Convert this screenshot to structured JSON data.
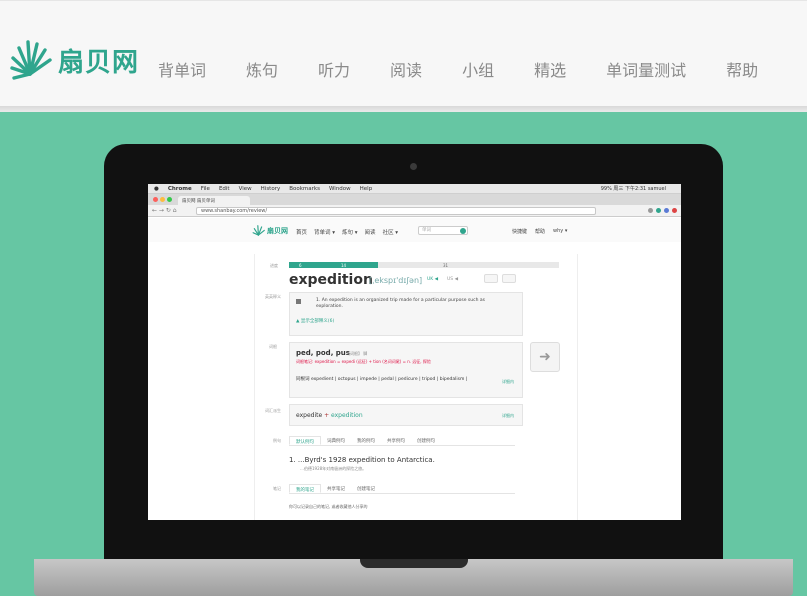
{
  "site": {
    "logo_text": "扇贝网",
    "logo_icon": "fan-shell-icon",
    "brand_color": "#2fa58d",
    "hero_color": "#66c6a3"
  },
  "nav": {
    "items": [
      "背单词",
      "炼句",
      "听力",
      "阅读",
      "小组",
      "精选",
      "单词量测试",
      "帮助"
    ]
  },
  "browser": {
    "menu": [
      "Chrome",
      "File",
      "Edit",
      "View",
      "History",
      "Bookmarks",
      "Window",
      "Help"
    ],
    "status": "99%  周三 下午2:31  samuel",
    "tab_title": "扇贝网  扇贝单词",
    "url": "www.shanbay.com/review/"
  },
  "inner_site": {
    "logo_text": "扇贝网",
    "nav": [
      "首页",
      "背单词 ▾",
      "炼句 ▾",
      "阅读",
      "社区 ▾"
    ],
    "search_placeholder": "单词",
    "right": [
      "快捷键",
      "帮助",
      "why ▾"
    ]
  },
  "review": {
    "side_labels": {
      "progress": "进度",
      "definition": "英英释义",
      "roots": "词根",
      "derivation": "词汇派生",
      "examples": "例句",
      "notes": "笔记"
    },
    "progress": {
      "done": "6",
      "current": "14",
      "total": "31",
      "fraction": 0.33
    },
    "word": "expedition",
    "phonetic": "[ˌekspɪ'dɪʃən]",
    "pron_uk": "UK ◀",
    "pron_us": "US ◀",
    "definition": "1.  An expedition is an organized trip made for a particular purpose such as exploration.",
    "show_all": "▲ 显示全部释义(6)",
    "root_title": "ped, pod, pus",
    "root_tag": "【词根】 脚",
    "root_note": "词根笔记: expedition = expedi (远征) + tion (名词词尾) = n. 远征, 探险",
    "root_words_label": "同根词",
    "root_words": "expedient | octopus | impede | pedal | pedicure | tripod | bipedalism |",
    "detail_link": "详细内",
    "derivation": {
      "base": "expedite",
      "plus": "+",
      "derived": "expedition"
    },
    "example_tabs": [
      "默认例句",
      "词典例句",
      "我的例句",
      "共享例句",
      "创建例句"
    ],
    "example_number": "1.",
    "example_sentence": "...Byrd's 1928 expedition to Antarctica.",
    "example_cn": "…伯德1928年对南极洲的探险之旅。",
    "note_tabs": [
      "我的笔记",
      "共享笔记",
      "创建笔记"
    ],
    "note_hint": "你可以记录自己的笔记, 或者收藏他人分享的"
  }
}
